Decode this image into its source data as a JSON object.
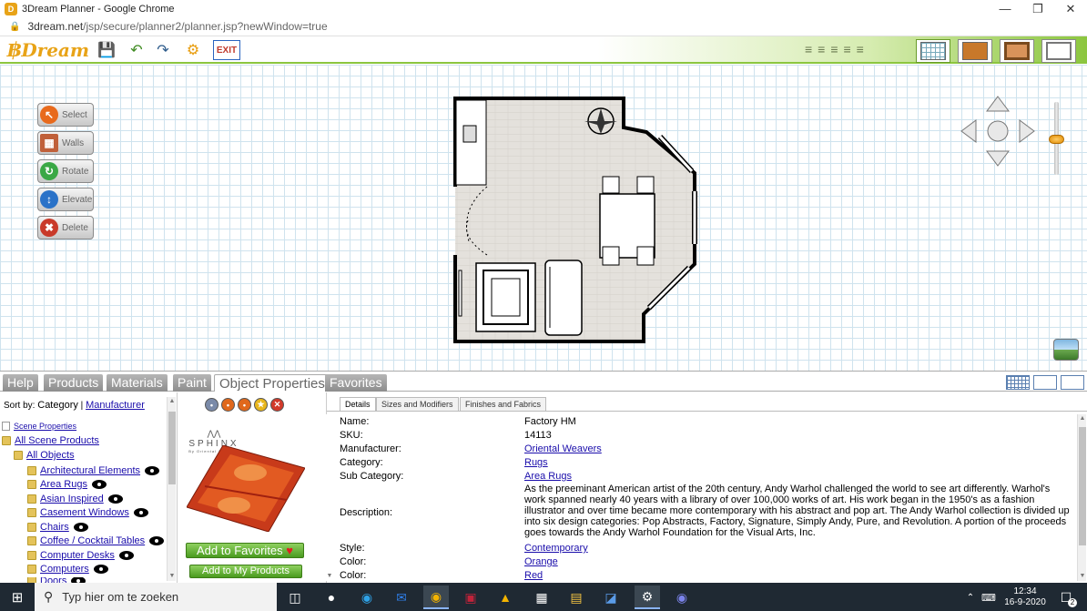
{
  "window": {
    "title": "3Dream Planner - Google Chrome",
    "app_icon": "D"
  },
  "address": {
    "host": "3dream.net",
    "path": "/jsp/secure/planner2/planner.jsp?newWindow=true"
  },
  "toolbar": {
    "logo": "Dream",
    "exit_label": "EXIT"
  },
  "tools": [
    {
      "name": "select",
      "label": "Select"
    },
    {
      "name": "walls",
      "label": "Walls"
    },
    {
      "name": "rotate",
      "label": "Rotate"
    },
    {
      "name": "elevate",
      "label": "Elevate"
    },
    {
      "name": "delete",
      "label": "Delete"
    }
  ],
  "tabs": [
    {
      "label": "Help"
    },
    {
      "label": "Products"
    },
    {
      "label": "Materials"
    },
    {
      "label": "Paint"
    },
    {
      "label": "Object Properties"
    },
    {
      "label": "Favorites"
    }
  ],
  "active_tab": "Object Properties",
  "sort": {
    "label": "Sort by:",
    "current": "Category",
    "sep": "|",
    "alt": "Manufacturer"
  },
  "tree": {
    "scene_props": "Scene Properties",
    "all_scene": "All Scene Products",
    "all_objects": "All Objects",
    "items": [
      "Architectural Elements",
      "Area Rugs",
      "Asian Inspired",
      "Casement Windows",
      "Chairs",
      "Coffee / Cocktail Tables",
      "Computer Desks",
      "Computers",
      "Doors"
    ]
  },
  "product": {
    "brand": "SPHINX",
    "brand_sub": "By Oriental Weavers",
    "add_fav": "Add to Favorites",
    "add_mine": "Add to My Products"
  },
  "detail_tabs": [
    "Details",
    "Sizes and Modifiers",
    "Finishes and Fabrics"
  ],
  "details": {
    "name_label": "Name:",
    "name": "Factory HM",
    "sku_label": "SKU:",
    "sku": "14113",
    "mfr_label": "Manufacturer:",
    "mfr": "Oriental Weavers",
    "cat_label": "Category:",
    "cat": "Rugs",
    "subcat_label": "Sub Category:",
    "subcat": "Area Rugs",
    "desc_label": "Description:",
    "desc": "As the preeminant American artist of the 20th century, Andy Warhol challenged the world to see art differently. Warhol's work spanned nearly 40 years with a library of over 100,000 works of art. His work began in the 1950's as a fashion illustrator and over time became more contemporary with his abstract and pop art. The Andy Warhol collection is divided up into six design categories: Pop Abstracts, Factory, Signature, Simply Andy, Pure, and Revolution. A portion of the proceeds goes towards the Andy Warhol Foundation for the Visual Arts, Inc.",
    "style_label": "Style:",
    "style": "Contemporary",
    "color1_label": "Color:",
    "color1": "Orange",
    "color2_label": "Color:",
    "color2": "Red"
  },
  "taskbar": {
    "search_placeholder": "Typ hier om te zoeken",
    "time": "12:34",
    "date": "16-9-2020",
    "notif": "2"
  },
  "colors": {
    "accent_green": "#8cc63f",
    "link": "#1a0dab",
    "tab_gray": "#9b9b9b"
  }
}
